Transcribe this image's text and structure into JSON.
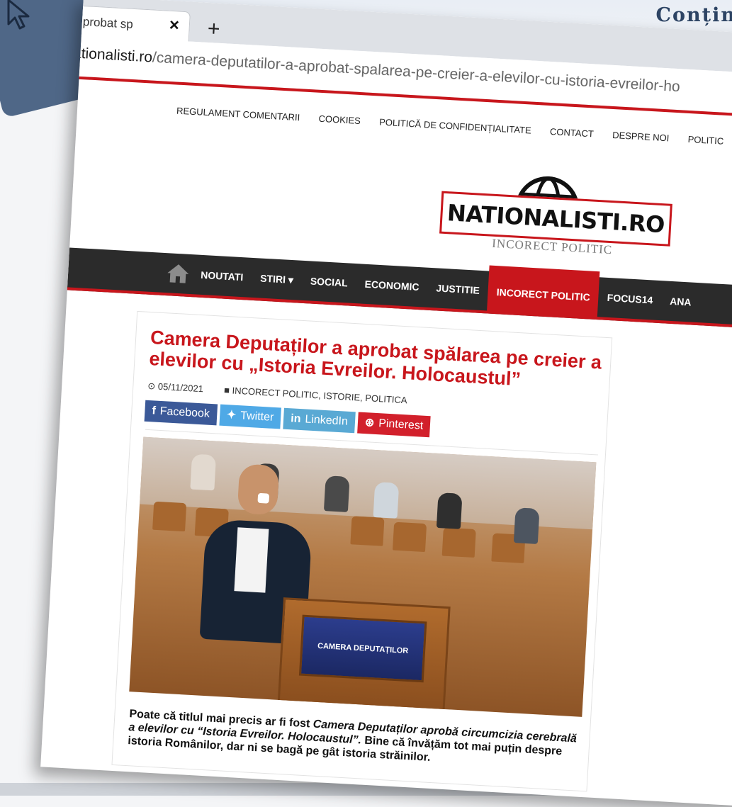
{
  "backdrop": {
    "heading": "Conțin"
  },
  "browser": {
    "tab_title": "probat sp",
    "tab_close": "×",
    "new_tab": "+",
    "url_host": "nationalisti.ro",
    "url_path": "/camera-deputatilor-a-aprobat-spalarea-pe-creier-a-elevilor-cu-istoria-evreilor-ho"
  },
  "site": {
    "top_links": [
      "REGULAMENT COMENTARII",
      "COOKIES",
      "POLITICĂ DE CONFIDENȚIALITATE",
      "CONTACT",
      "DESPRE NOI",
      "POLITIC"
    ],
    "logo_text": "NATIONALISTI.RO",
    "logo_subtitle": "INCORECT POLITIC",
    "nav": [
      {
        "label": "NOUTATI"
      },
      {
        "label": "STIRI ▾"
      },
      {
        "label": "SOCIAL"
      },
      {
        "label": "ECONOMIC"
      },
      {
        "label": "JUSTITIE"
      },
      {
        "label": "INCORECT POLITIC"
      },
      {
        "label": "FOCUS14"
      },
      {
        "label": "ANA"
      }
    ],
    "active_color": "#c8161c"
  },
  "article": {
    "title": "Camera Deputaților a aprobat spălarea pe creier a elevilor cu „Istoria Evreilor. Holocaustul”",
    "date": "05/11/2021",
    "categories": "INCORECT POLITIC, ISTORIE, POLITICA",
    "share": {
      "facebook": "Facebook",
      "twitter": "Twitter",
      "linkedin": "LinkedIn",
      "pinterest": "Pinterest"
    },
    "photo_sign": "CAMERA DEPUTAȚILOR",
    "body_1": "Poate că titlul mai precis ar fi fost ",
    "body_em": "Camera Deputaților aprobă circumcizia cerebrală a elevilor cu “Istoria Evreilor. Holocaustul”.",
    "body_2": " Bine că învățăm tot mai puțin despre istoria Românilor, dar ni se bagă pe gât istoria străinilor."
  }
}
